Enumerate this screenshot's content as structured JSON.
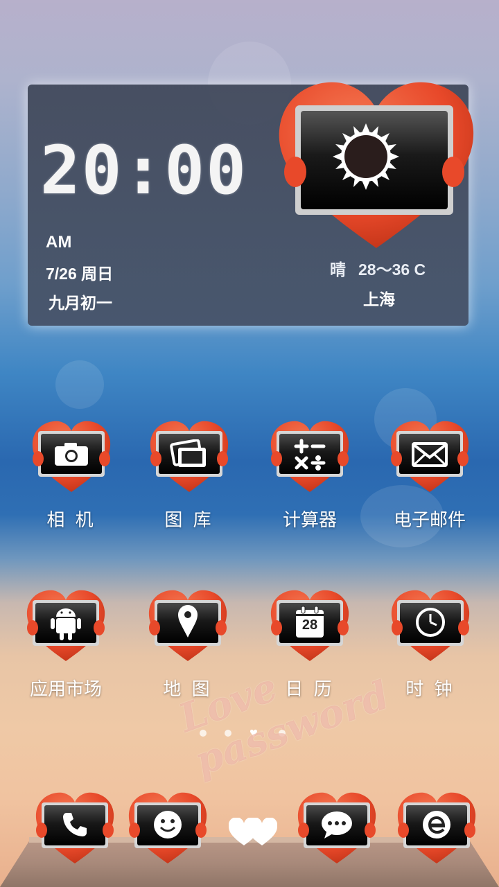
{
  "widget": {
    "time": "20:00",
    "ampm": "AM",
    "date": "7/26 周日",
    "lunar_date": "九月初一",
    "weather_condition": "晴",
    "temperature": "28～36 C",
    "city": "上海",
    "weather_icon": "sun-icon"
  },
  "apps_row1": [
    {
      "label": "相 机",
      "icon": "camera-icon"
    },
    {
      "label": "图 库",
      "icon": "gallery-icon"
    },
    {
      "label": "计算器",
      "icon": "calculator-icon"
    },
    {
      "label": "电子邮件",
      "icon": "mail-icon"
    }
  ],
  "apps_row2": [
    {
      "label": "应用市场",
      "icon": "android-icon"
    },
    {
      "label": "地 图",
      "icon": "map-pin-icon"
    },
    {
      "label": "日 历",
      "icon": "calendar-icon",
      "badge": "28"
    },
    {
      "label": "时 钟",
      "icon": "clock-icon"
    }
  ],
  "page_indicator": {
    "pages": 4,
    "current": 3
  },
  "watermark": "Love password",
  "dock": [
    {
      "icon": "phone-icon"
    },
    {
      "icon": "smiley-icon"
    },
    {
      "icon": "hearts-icon"
    },
    {
      "icon": "message-icon"
    },
    {
      "icon": "browser-icon"
    }
  ],
  "colors": {
    "heart": "#e8492a",
    "heart_dark": "#c23619",
    "screen": "#111111"
  }
}
